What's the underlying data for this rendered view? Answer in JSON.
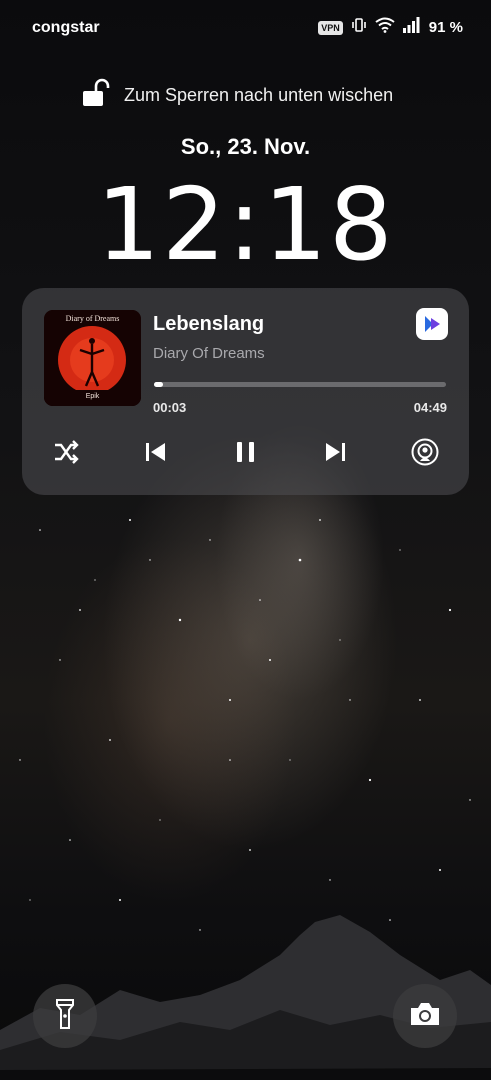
{
  "status_bar": {
    "carrier": "congstar",
    "vpn_label": "VPN",
    "battery": "91 %",
    "icons": [
      "vpn-icon",
      "vibrate-icon",
      "wifi-icon",
      "signal-icon"
    ]
  },
  "lock": {
    "hint": "Zum Sperren nach unten wischen",
    "icon": "unlock-icon",
    "date": "So., 23. Nov.",
    "time": "12:18"
  },
  "media": {
    "title": "Lebenslang",
    "artist": "Diary Of Dreams",
    "album_art_title": "Diary of Dreams",
    "album_art_subtitle": "Epik",
    "elapsed": "00:03",
    "duration": "04:49",
    "progress_fraction": 0.0104,
    "controls": [
      "shuffle-icon",
      "previous-icon",
      "pause-icon",
      "next-icon",
      "cast-icon"
    ]
  },
  "shortcuts": {
    "left": "flashlight-icon",
    "right": "camera-icon"
  },
  "colors": {
    "card_bg": "#505054",
    "text": "#ffffff",
    "secondary_text": "#a9a9ad",
    "album_red": "#d42a14"
  }
}
